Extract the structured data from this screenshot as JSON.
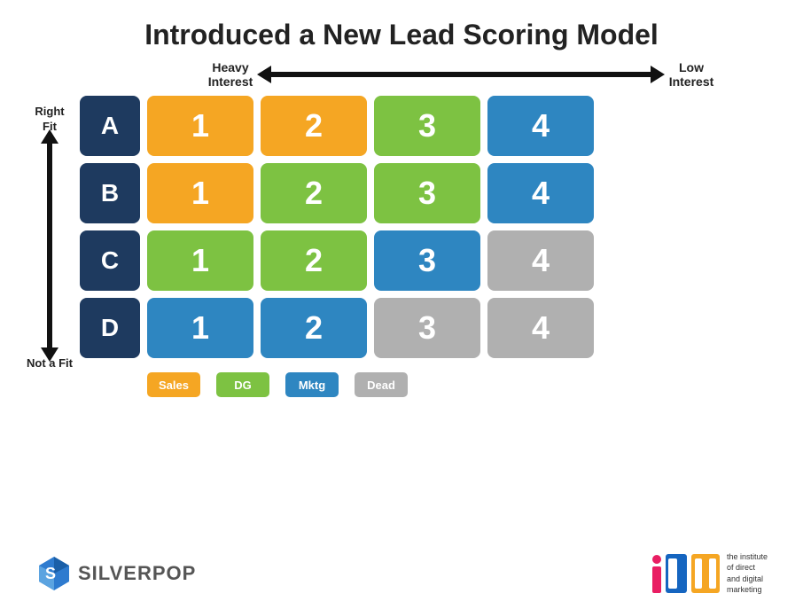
{
  "page": {
    "title": "Introduced a New Lead Scoring Model",
    "interest_axis": {
      "heavy_label": "Heavy\nInterest",
      "low_label": "Low\nInterest"
    },
    "fit_axis": {
      "top_label": "Right\nFit",
      "bottom_label": "Not a Fit"
    },
    "rows": [
      {
        "label": "A",
        "cells": [
          {
            "value": "1",
            "color": "orange"
          },
          {
            "value": "2",
            "color": "orange"
          },
          {
            "value": "3",
            "color": "green"
          },
          {
            "value": "4",
            "color": "blue"
          }
        ]
      },
      {
        "label": "B",
        "cells": [
          {
            "value": "1",
            "color": "orange"
          },
          {
            "value": "2",
            "color": "green"
          },
          {
            "value": "3",
            "color": "green"
          },
          {
            "value": "4",
            "color": "blue"
          }
        ]
      },
      {
        "label": "C",
        "cells": [
          {
            "value": "1",
            "color": "green"
          },
          {
            "value": "2",
            "color": "green"
          },
          {
            "value": "3",
            "color": "blue"
          },
          {
            "value": "4",
            "color": "gray"
          }
        ]
      },
      {
        "label": "D",
        "cells": [
          {
            "value": "1",
            "color": "blue"
          },
          {
            "value": "2",
            "color": "blue"
          },
          {
            "value": "3",
            "color": "gray"
          },
          {
            "value": "4",
            "color": "gray"
          }
        ]
      }
    ],
    "legend": [
      {
        "label": "Sales",
        "color": "orange"
      },
      {
        "label": "DG",
        "color": "green"
      },
      {
        "label": "Mktg",
        "color": "blue"
      },
      {
        "label": "Dead",
        "color": "gray"
      }
    ],
    "footer": {
      "silverpop_text": "SILVERPOP",
      "idm_text": "the institute\nof direct\nand digital\nmarketing"
    }
  }
}
